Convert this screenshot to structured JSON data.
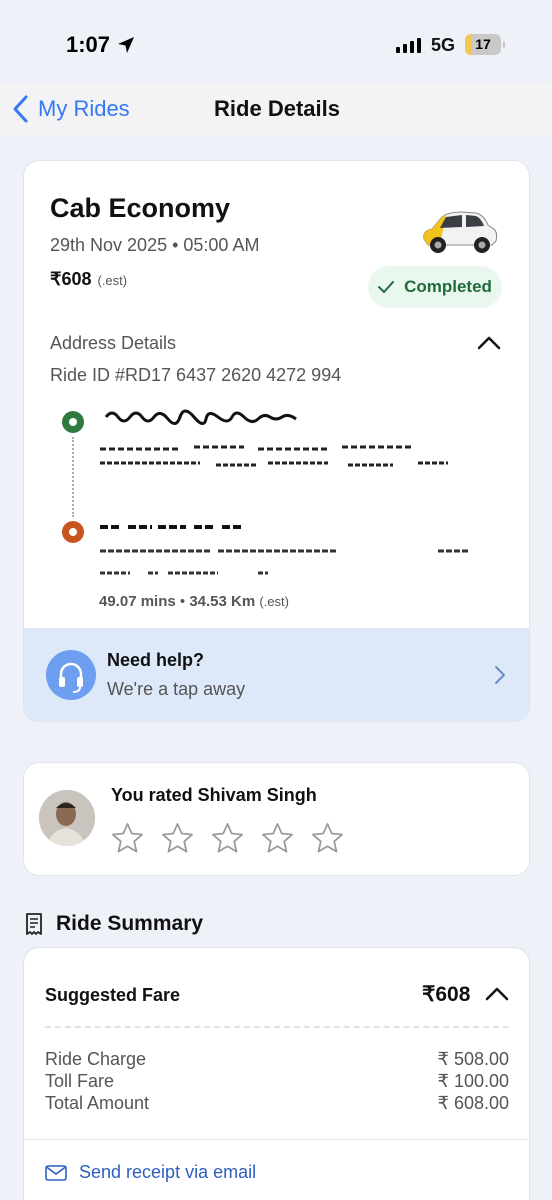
{
  "status_bar": {
    "time": "1:07",
    "network": "5G",
    "battery": "17",
    "battery_level": 0.17
  },
  "nav": {
    "back_label": "My Rides",
    "title": "Ride Details"
  },
  "ride": {
    "title": "Cab Economy",
    "date": "29th Nov 2025 • 05:00 AM",
    "fare": "₹608",
    "fare_note": "(.est)",
    "status": "Completed",
    "address_heading": "Address Details",
    "ride_id": "Ride ID #RD17 6437 2620 4272 994",
    "duration": "49.07 mins",
    "distance": "34.53 Km",
    "stats_note": "(.est)"
  },
  "help": {
    "title": "Need help?",
    "subtitle": "We're a tap away"
  },
  "rating": {
    "text": "You rated Shivam Singh",
    "stars_filled": 0,
    "stars_total": 5
  },
  "summary": {
    "heading": "Ride Summary",
    "fare_label": "Suggested Fare",
    "fare_amount": "₹608",
    "items": [
      {
        "label": "Ride Charge",
        "value": "₹ 508.00"
      },
      {
        "label": "Toll Fare",
        "value": "₹ 100.00"
      },
      {
        "label": "Total Amount",
        "value": "₹ 608.00"
      }
    ],
    "receipt_label": "Send receipt via email"
  },
  "colors": {
    "accent": "#3478f6",
    "completed": "#1e6b3c",
    "pickup": "#2f7a3e",
    "drop": "#c8541f",
    "help_bg": "#dde9f9"
  },
  "icons": [
    "location-arrow-icon",
    "signal-icon",
    "battery-icon",
    "chevron-left-icon",
    "car-icon",
    "checkmark-icon",
    "chevron-up-icon",
    "pickup-dot-icon",
    "drop-dot-icon",
    "headset-icon",
    "chevron-right-icon",
    "star-icon",
    "receipt-icon",
    "mail-icon"
  ]
}
